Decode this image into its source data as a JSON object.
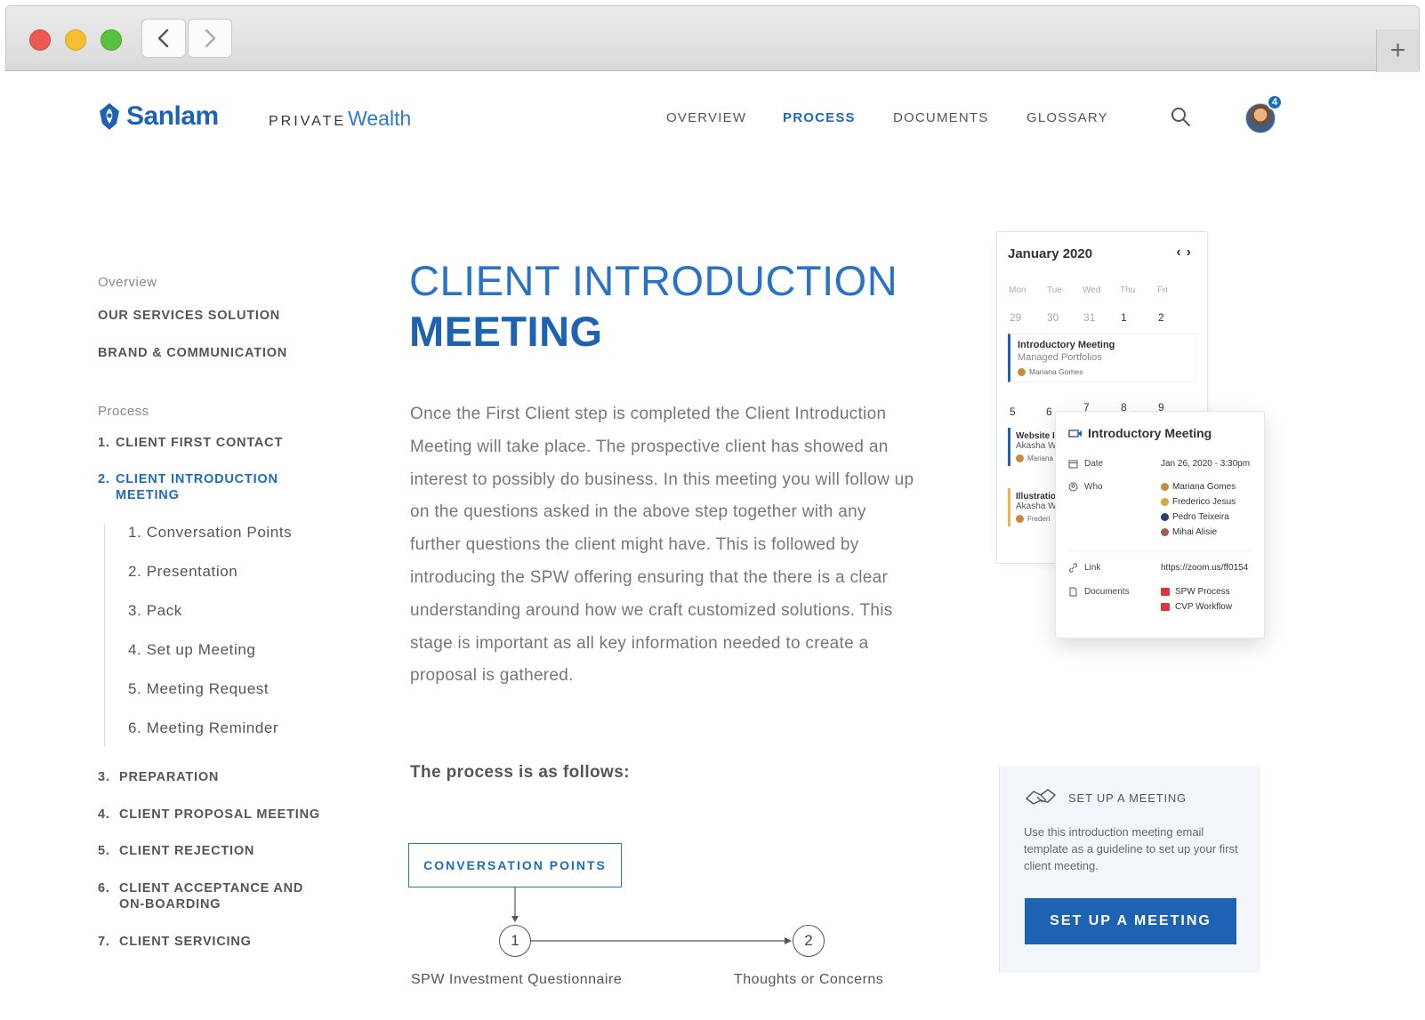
{
  "header": {
    "brand": "Sanlam",
    "sub_brand_private": "PRIVATE",
    "sub_brand_wealth": "Wealth",
    "nav": [
      {
        "label": "OVERVIEW"
      },
      {
        "label": "PROCESS"
      },
      {
        "label": "DOCUMENTS"
      },
      {
        "label": "GLOSSARY"
      }
    ],
    "notification_count": "4",
    "accent_color": "#1e63b3"
  },
  "sidebar": {
    "overview_label": "Overview",
    "overview_items": [
      {
        "label": "OUR SERVICES SOLUTION"
      },
      {
        "label": "BRAND & COMMUNICATION"
      }
    ],
    "process_label": "Process",
    "process_items": [
      {
        "num": "1.",
        "label": "CLIENT FIRST CONTACT"
      },
      {
        "num": "2.",
        "label_line1": "CLIENT INTRODUCTION",
        "label_line2": "MEETING"
      },
      {
        "num": "3.",
        "label": "PREPARATION"
      },
      {
        "num": "4.",
        "label": "CLIENT PROPOSAL MEETING"
      },
      {
        "num": "5.",
        "label": "CLIENT REJECTION"
      },
      {
        "num": "6.",
        "label_line1": "CLIENT ACCEPTANCE AND",
        "label_line2": "ON-BOARDING"
      },
      {
        "num": "7.",
        "label": "CLIENT SERVICING"
      }
    ],
    "sub_items": [
      {
        "label": "1. Conversation Points"
      },
      {
        "label": "2. Presentation"
      },
      {
        "label": "3. Pack"
      },
      {
        "label": "4. Set up Meeting"
      },
      {
        "label": "5. Meeting Request"
      },
      {
        "label": "6. Meeting Reminder"
      }
    ]
  },
  "main": {
    "title_line1": "CLIENT INTRODUCTION",
    "title_line2": "MEETING",
    "paragraph": "Once the First Client step is completed the Client Introduction Meeting will take place. The prospective client has showed an interest to possibly do business. In this meeting you will follow up on the questions asked in the above step together with any further questions the client might have. This is followed by introducing the SPW offering ensuring that the there is a clear understanding around how we craft customized solutions. This stage is important as all key information needed to create a proposal is gathered.",
    "process_heading": "The process is as follows:",
    "flow_box": "CONVERSATION POINTS",
    "steps": [
      {
        "num": "1",
        "label": "SPW Investment Questionnaire"
      },
      {
        "num": "2",
        "label": "Thoughts or Concerns"
      }
    ]
  },
  "calendar": {
    "month": "January 2020",
    "dow": [
      "Mon",
      "Tue",
      "Wed",
      "Thu",
      "Fri"
    ],
    "week1": [
      "29",
      "30",
      "31",
      "1",
      "2"
    ],
    "week2": [
      "5",
      "6",
      "7",
      "8",
      "9"
    ],
    "event_main": {
      "title": "Introductory Meeting",
      "subtitle": "Managed Portfolios",
      "person": "Mariana Gomes"
    },
    "event_a": {
      "title": "Website I",
      "subtitle": "Akasha W",
      "person": "Mariana"
    },
    "event_b": {
      "title": "Illustratio",
      "subtitle": "Akasha W",
      "person": "Frederi"
    },
    "popup": {
      "title": "Introductory Meeting",
      "date_label": "Date",
      "date_value": "Jan 26, 2020 - 3:30pm",
      "who_label": "Who",
      "people": [
        "Mariana Gomes",
        "Frederico Jesus",
        "Pedro Teixeira",
        "Mihai Alisie"
      ],
      "link_label": "Link",
      "link_value": "https://zoom.us/ff0154",
      "documents_label": "Documents",
      "documents": [
        "SPW Process",
        "CVP Workflow"
      ]
    }
  },
  "setup_card": {
    "heading": "SET UP A MEETING",
    "text": "Use this introduction meeting email template as a guideline to set up your first client meeting.",
    "button": "SET UP A MEETING"
  }
}
